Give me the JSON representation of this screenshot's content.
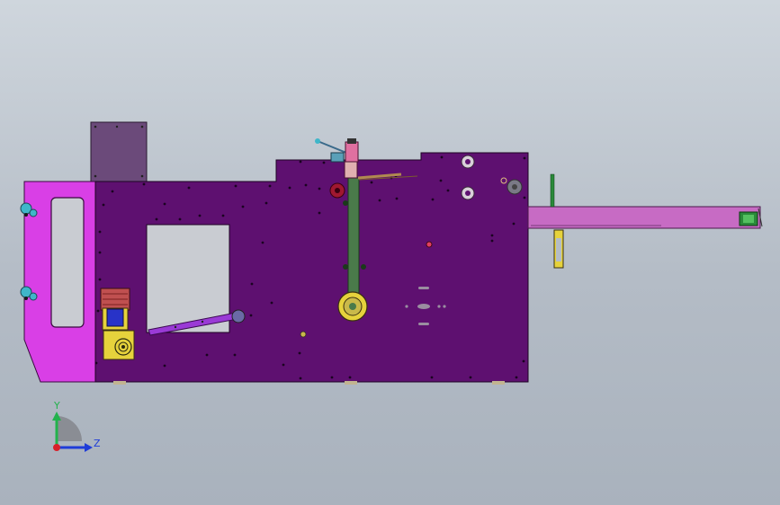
{
  "viewport": {
    "background_top": "#cfd6dd",
    "background_bottom": "#a9b2bd"
  },
  "model": {
    "colors": {
      "frame_main": "#5e1070",
      "frame_left": "#d93fe6",
      "hopper": "#6b4a7a",
      "conveyor": "#c76bc4",
      "arm": "#4a7a4a",
      "motor_red": "#c05050",
      "motor_blue": "#2833c8",
      "gear_yellow": "#e6d23c",
      "slide_violet": "#9a3ad6"
    },
    "parts": [
      "hopper",
      "main-frame",
      "left-side-plate",
      "conveyor-arm",
      "crank-arm",
      "drive-motor",
      "gearbox",
      "feed-slide",
      "top-valve-assembly"
    ]
  },
  "triad": {
    "y_label": "Y",
    "z_label": "Z",
    "y_color": "#22b24c",
    "z_color": "#1e3cd8",
    "x_color": "#d8202a"
  }
}
